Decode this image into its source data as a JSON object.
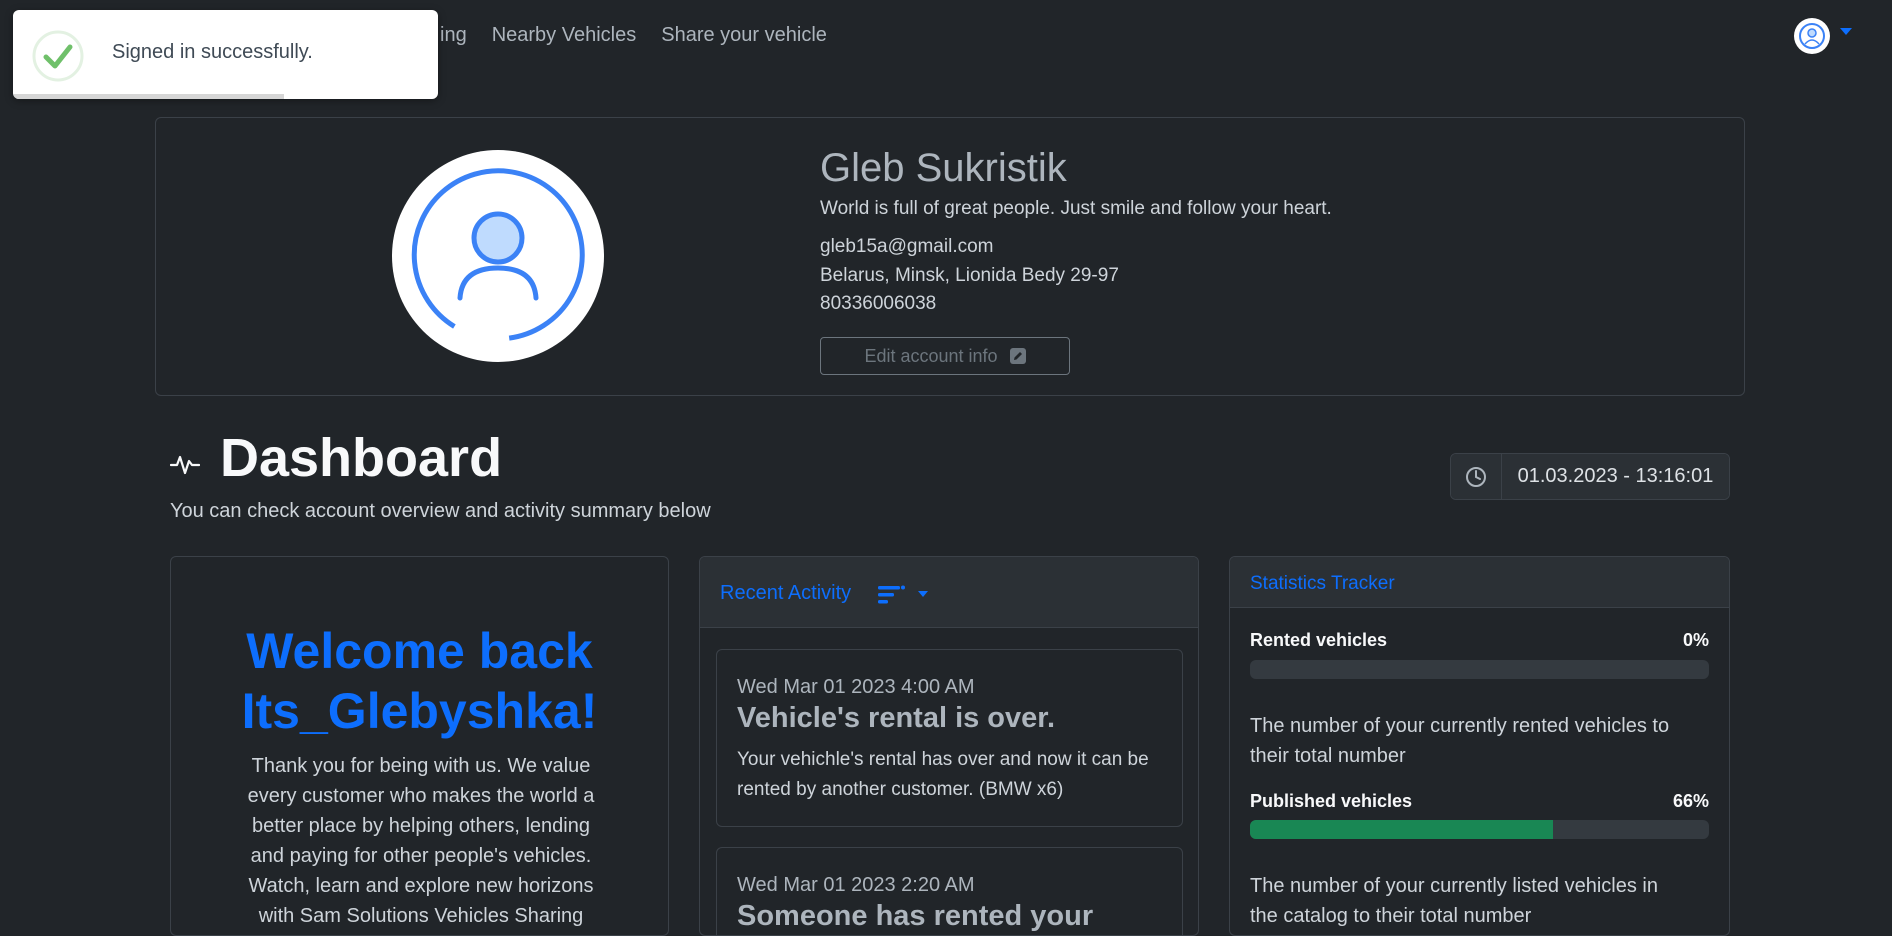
{
  "nav": {
    "links": [
      "ing",
      "Nearby Vehicles",
      "Share your vehicle"
    ],
    "accent_color": "#0d6efd"
  },
  "toast": {
    "message": "Signed in successfully.",
    "icon": "check-circle-icon"
  },
  "profile": {
    "name": "Gleb Sukristik",
    "bio": "World is full of great people. Just smile and follow your heart.",
    "email": "gleb15a@gmail.com",
    "address": "Belarus, Minsk, Lionida Bedy 29-97",
    "phone": "80336006038",
    "edit_label": "Edit account info"
  },
  "dashboard": {
    "title": "Dashboard",
    "subtitle": "You can check account overview and activity summary below",
    "datetime": "01.03.2023 - 13:16:01"
  },
  "welcome": {
    "title_line1": "Welcome back",
    "title_line2": "Its_Glebyshka!",
    "text": "Thank you for being with us. We value every customer who makes the world a better place by helping others, lending and paying for other people's vehicles. Watch, learn and explore new horizons with Sam Solutions Vehicles Sharing"
  },
  "activity": {
    "title": "Recent Activity",
    "items": [
      {
        "date": "Wed Mar 01 2023 4:00 AM",
        "title": "Vehicle's rental is over.",
        "text": "Your vehichle's rental has over and now it can be rented by another customer. (BMW x6)"
      },
      {
        "date": "Wed Mar 01 2023 2:20 AM",
        "title": "Someone has rented your",
        "text": ""
      }
    ]
  },
  "stats": {
    "title": "Statistics Tracker",
    "items": [
      {
        "label": "Rented vehicles",
        "percent_label": "0%",
        "percent": 0,
        "description": "The number of your currently rented vehicles to their total number"
      },
      {
        "label": "Published vehicles",
        "percent_label": "66%",
        "percent": 66,
        "description": "The number of your currently listed vehicles in the catalog to their total number"
      }
    ],
    "fill_color": "#198754"
  }
}
